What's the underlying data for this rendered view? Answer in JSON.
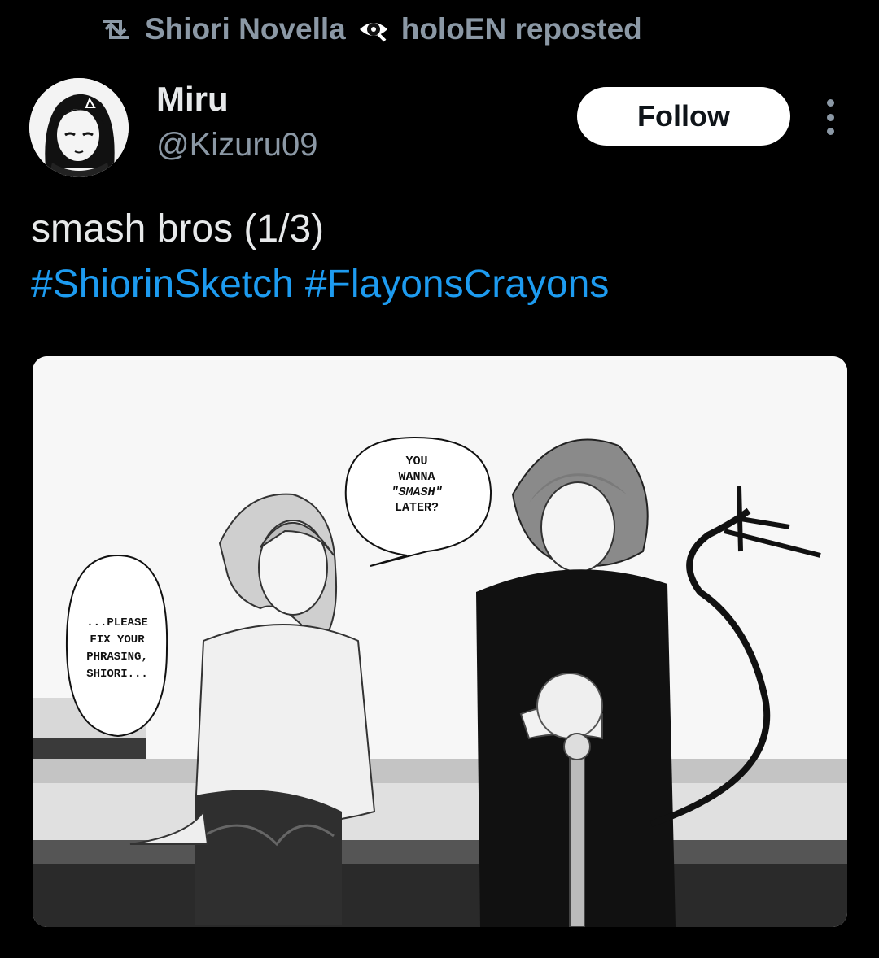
{
  "repost": {
    "icon": "repost-icon",
    "name": "Shiori Novella",
    "badge_icon": "eye-icon",
    "suffix": "holoEN reposted"
  },
  "author": {
    "name": "Miru",
    "handle": "@Kizuru09",
    "avatar_icon": "avatar"
  },
  "follow_label": "Follow",
  "post": {
    "text": "smash bros (1/3)",
    "hashtags": [
      "#ShiorinSketch",
      "#FlayonsCrayons"
    ]
  },
  "media": {
    "bubble_right": [
      "YOU",
      "WANNA",
      "\"SMASH\"",
      "LATER?"
    ],
    "bubble_left": [
      "...PLEASE",
      "FIX YOUR",
      "PHRASING,",
      "SHIORI..."
    ]
  },
  "colors": {
    "background": "#000000",
    "text": "#e7e9ea",
    "secondary": "#8b98a5",
    "link": "#1d9bf0"
  }
}
